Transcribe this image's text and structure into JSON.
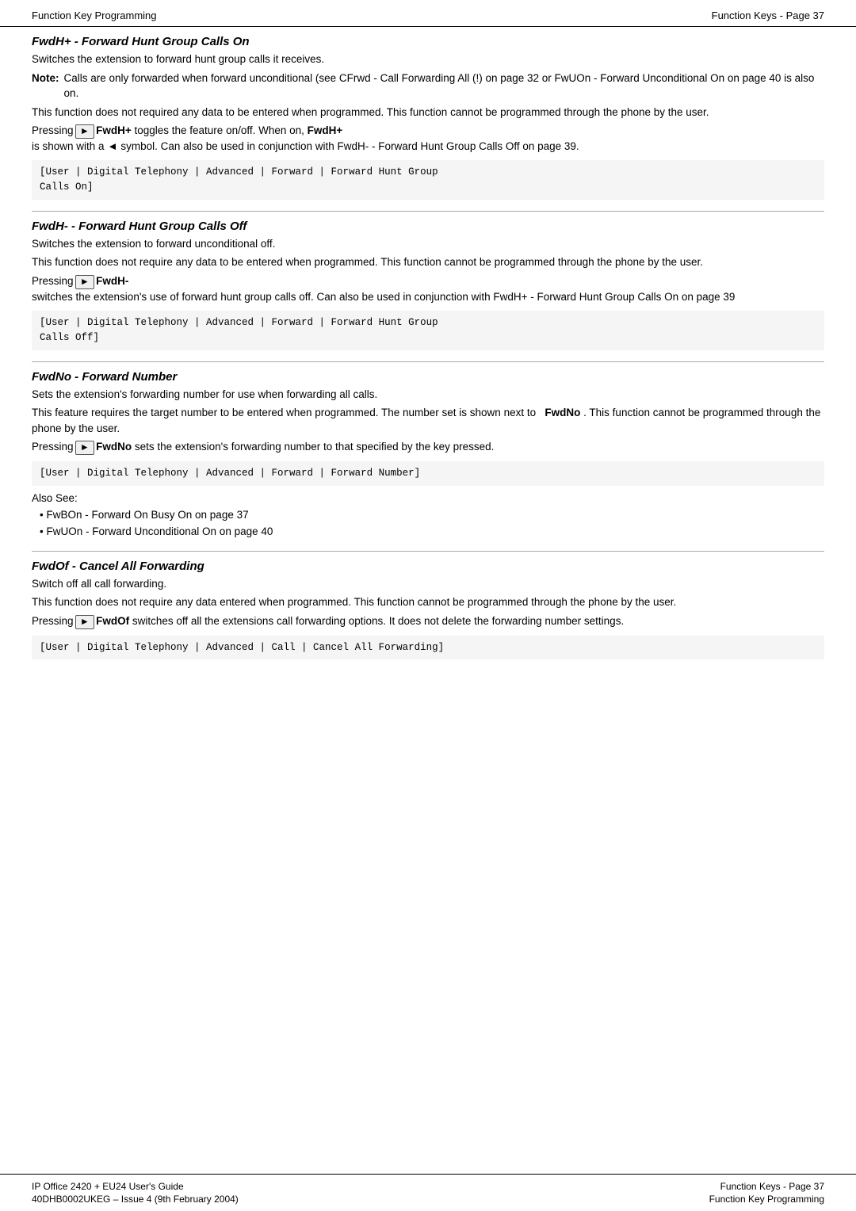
{
  "header": {
    "left": "Function Key Programming",
    "right": "Function Keys - Page 37"
  },
  "footer": {
    "left_line1": "IP Office 2420 + EU24 User's Guide",
    "left_line2": "40DHB0002UKEG – Issue 4 (9th February 2004)",
    "right_line1": "Function Keys - Page 37",
    "right_line2": "Function Key Programming"
  },
  "sections": [
    {
      "id": "fwdh-plus",
      "title": "FwdH+ - Forward Hunt Group Calls On",
      "body1": "Switches the extension to forward hunt group calls it receives.",
      "note_label": "Note:",
      "note_text": "Calls are only forwarded when forward unconditional (see CFrwd - Call Forwarding All (!) on page 32 or FwUOn - Forward Unconditional On on page 40 is also on.",
      "body2": "This function does not required any data to be entered when programmed. This function cannot be programmed through the phone by the user.",
      "pressing_prefix": "Pressing",
      "pressing_key": "FwdH+",
      "pressing_suffix": "toggles the feature on/off. When on,",
      "pressing_key2": "FwdH+",
      "pressing_suffix2": "is shown with a ◄ symbol. Can also be used in conjunction with FwdH- - Forward Hunt Group Calls Off on page 39.",
      "code": "[User | Digital Telephony | Advanced | Forward | Forward Hunt Group\nCalls On]"
    },
    {
      "id": "fwdh-minus",
      "title": "FwdH- - Forward Hunt Group Calls Off",
      "body1": "Switches the extension to forward unconditional off.",
      "body2": "This function does not require any data to be entered when programmed. This function cannot be programmed through the phone by the user.",
      "pressing_prefix": "Pressing",
      "pressing_key": "FwdH-",
      "pressing_suffix": "switches the extension's use of forward hunt group calls off. Can also be used in conjunction with FwdH+ - Forward Hunt Group Calls On on page 39",
      "code": "[User | Digital Telephony | Advanced | Forward | Forward Hunt Group\nCalls Off]"
    },
    {
      "id": "fwdno",
      "title": "FwdNo - Forward Number",
      "body1": "Sets the extension's forwarding number for use when forwarding all calls.",
      "body2": "This feature requires the target number to be entered when programmed. The number set is shown next to",
      "body2_key": "FwdNo",
      "body2_suffix": ". This function cannot be programmed through the phone by the user.",
      "pressing_prefix": "Pressing",
      "pressing_key": "FwdNo",
      "pressing_suffix": "sets the extension's forwarding number to that specified by the key pressed.",
      "code": "[User | Digital Telephony | Advanced | Forward | Forward Number]",
      "also_see": "Also See:",
      "bullets": [
        "FwBOn - Forward On Busy On on page 37",
        "FwUOn - Forward Unconditional On on page 40"
      ]
    },
    {
      "id": "fwdof",
      "title": "FwdOf - Cancel All Forwarding",
      "body1": "Switch off all call forwarding.",
      "body2": "This function does not require any data entered when programmed. This function cannot be programmed through the phone by the user.",
      "pressing_prefix": "Pressing",
      "pressing_key": "FwdOf",
      "pressing_suffix": "switches off all the extensions call forwarding options. It does not delete the forwarding number settings.",
      "code": "[User | Digital Telephony | Advanced | Call | Cancel All Forwarding]"
    }
  ]
}
